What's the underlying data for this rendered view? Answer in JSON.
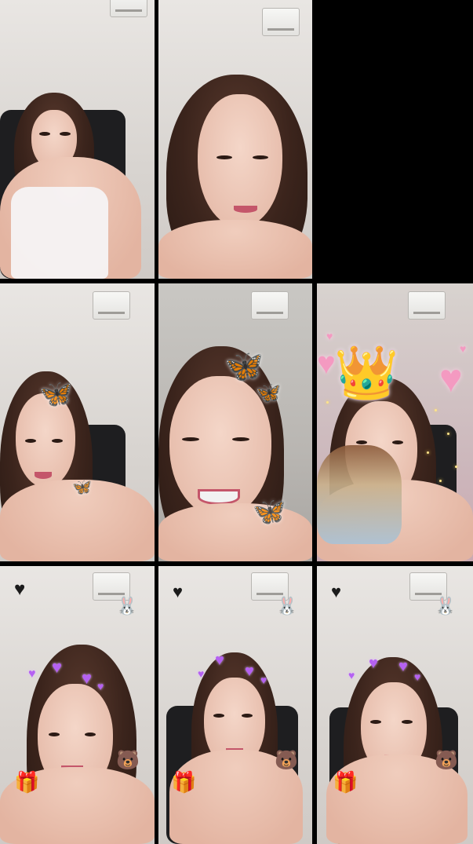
{
  "layout": {
    "background_color": "#000000",
    "rows": 3,
    "columns": 3
  },
  "tiles": [
    {
      "slot": "r1c1",
      "filter": "none"
    },
    {
      "slot": "r1c2",
      "filter": "none"
    },
    {
      "slot": "r1c3",
      "filter": "empty"
    },
    {
      "slot": "r2c1",
      "filter": "butterfly"
    },
    {
      "slot": "r2c2",
      "filter": "butterfly"
    },
    {
      "slot": "r2c3",
      "filter": "crown"
    },
    {
      "slot": "r3c1",
      "filter": "hearts"
    },
    {
      "slot": "r3c2",
      "filter": "hearts"
    },
    {
      "slot": "r3c3",
      "filter": "hearts"
    }
  ],
  "effects": {
    "butterfly_icon": "butterfly-icon",
    "heart_icon": "heart-icon",
    "crown_icon": "crown-icon",
    "bear_icon": "bear-icon",
    "bunny_icon": "bunny-icon",
    "gem_heart_icon": "gem-heart-icon",
    "accent_purple": "#b561f2",
    "accent_pink": "#f49ac1"
  }
}
